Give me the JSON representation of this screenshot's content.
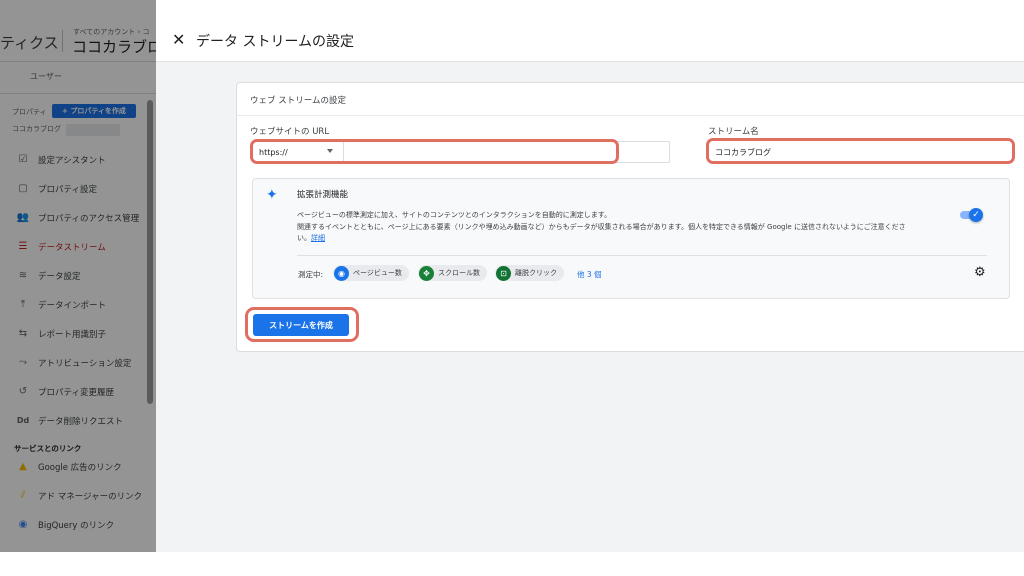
{
  "background": {
    "app_title": "ティクス",
    "account_path": "すべてのアカウント › コ",
    "account_name": "ココカラブロ",
    "tab_user": "ユーザー",
    "property_label": "プロパティ",
    "create_property_label": "+ プロパティを作成",
    "property_name": "ココカラブログ",
    "nav_items": [
      {
        "label": "設定アシスタント",
        "icon": "checklist-icon"
      },
      {
        "label": "プロパティ設定",
        "icon": "property-settings-icon"
      },
      {
        "label": "プロパティのアクセス管理",
        "icon": "people-icon"
      },
      {
        "label": "データストリーム",
        "icon": "data-stream-icon",
        "active": true
      },
      {
        "label": "データ設定",
        "icon": "database-icon"
      },
      {
        "label": "データインポート",
        "icon": "upload-icon"
      },
      {
        "label": "レポート用識別子",
        "icon": "reporting-identity-icon"
      },
      {
        "label": "アトリビューション設定",
        "icon": "attribution-icon"
      },
      {
        "label": "プロパティ変更履歴",
        "icon": "history-icon"
      },
      {
        "label": "データ削除リクエスト",
        "icon": "dd-icon"
      }
    ],
    "links_heading": "サービスとのリンク",
    "link_items": [
      {
        "label": "Google 広告のリンク",
        "icon": "google-ads-icon"
      },
      {
        "label": "アド マネージャーのリンク",
        "icon": "ad-manager-icon"
      },
      {
        "label": "BigQuery のリンク",
        "icon": "bigquery-icon"
      }
    ]
  },
  "panel": {
    "title": "データ ストリームの設定",
    "close_icon": "close-icon"
  },
  "card": {
    "title": "ウェブ ストリームの設定",
    "url_label": "ウェブサイトの URL",
    "protocol_value": "https://",
    "url_value": "",
    "stream_name_label": "ストリーム名",
    "stream_name_value": "ココカラブログ",
    "enhanced": {
      "title": "拡張計測機能",
      "desc_line1": "ページビューの標準測定に加え、サイトのコンテンツとのインタラクションを自動的に測定します。",
      "desc_line2": "関連するイベントとともに、ページ上にある要素（リンクや埋め込み動画など）からもデータが収集される場合があります。個人を特定できる情報が Google に送信されないようにご注意くださ",
      "desc_line3": "い。",
      "detail_link": "詳細",
      "toggle_on": true,
      "measuring_label": "測定中:",
      "chips": [
        {
          "label": "ページビュー数",
          "icon": "eye-icon"
        },
        {
          "label": "スクロール数",
          "icon": "scroll-icon"
        },
        {
          "label": "離脱クリック",
          "icon": "outbound-click-icon"
        }
      ],
      "more_label": "他 3 個"
    },
    "create_button_label": "ストリームを作成"
  },
  "colors": {
    "accent": "#1a73e8",
    "highlight": "#e06f62",
    "active_nav": "#c5221f"
  }
}
